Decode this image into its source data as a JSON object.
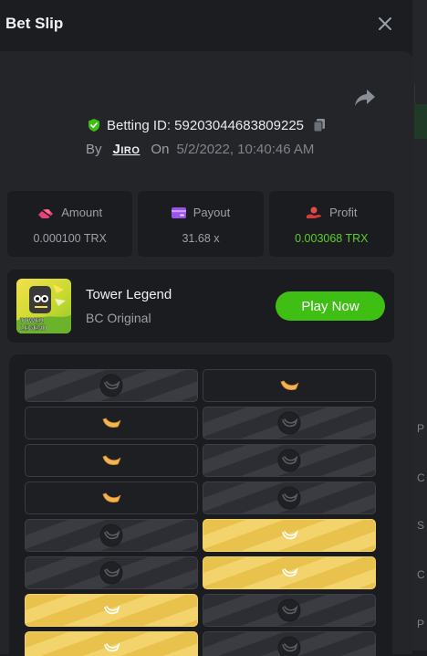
{
  "header": {
    "title": "Bet Slip"
  },
  "bet": {
    "id_text": "Betting ID: 59203044683809225",
    "by_label": "By",
    "user": "Jiro",
    "on_label": "On",
    "date": "5/2/2022, 10:40:46 AM"
  },
  "stats": {
    "amount": {
      "label": "Amount",
      "value": "0.000100 TRX"
    },
    "payout": {
      "label": "Payout",
      "value": "31.68 x"
    },
    "profit": {
      "label": "Profit",
      "value": "0.003068 TRX"
    }
  },
  "game": {
    "name": "Tower Legend",
    "provider": "BC Original",
    "play_label": "Play Now",
    "thumb_text": "TOWER LEGEND"
  },
  "board": {
    "rows": [
      [
        "empty",
        "banana"
      ],
      [
        "banana",
        "empty"
      ],
      [
        "banana",
        "empty"
      ],
      [
        "banana",
        "empty"
      ],
      [
        "empty",
        "gold"
      ],
      [
        "empty",
        "gold"
      ],
      [
        "gold",
        "empty"
      ],
      [
        "gold",
        "empty"
      ]
    ]
  },
  "background": {
    "side_letters": [
      "P",
      "C",
      "S",
      "C",
      "P"
    ]
  },
  "colors": {
    "accent_green": "#3fbe14",
    "profit_green": "#5dcc29",
    "gold": "#f3d46c"
  }
}
